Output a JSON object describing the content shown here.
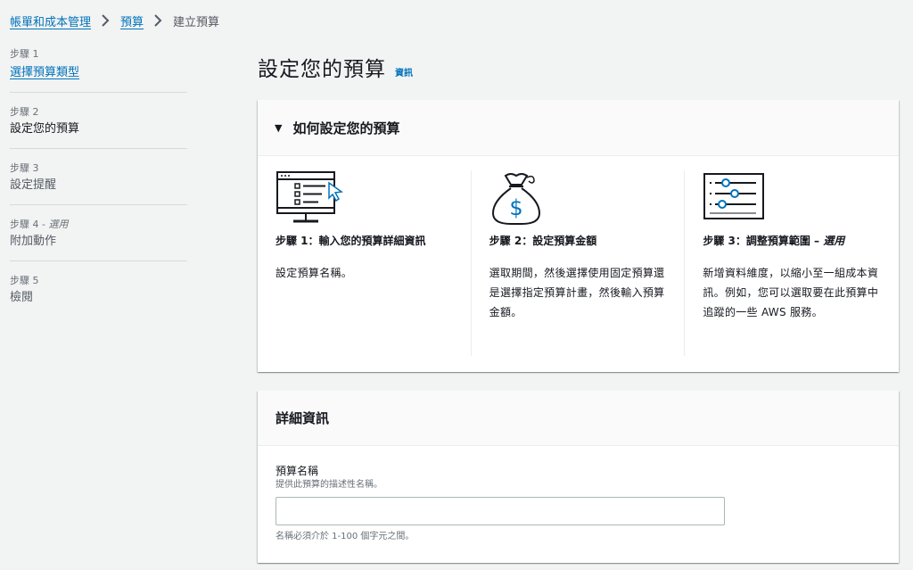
{
  "breadcrumb": {
    "items": [
      "帳單和成本管理",
      "預算"
    ],
    "current": "建立預算"
  },
  "steps": [
    {
      "num": "步驟 1",
      "label": "選擇預算類型",
      "state": "link"
    },
    {
      "num": "步驟 2",
      "label": "設定您的預算",
      "state": "active"
    },
    {
      "num": "步驟 3",
      "label": "設定提醒",
      "state": "disabled"
    },
    {
      "num": "步驟 4 -",
      "optional": "選用",
      "label": "附加動作",
      "state": "disabled"
    },
    {
      "num": "步驟 5",
      "label": "檢閱",
      "state": "disabled"
    }
  ],
  "main": {
    "title": "設定您的預算",
    "info_link": "資訊"
  },
  "how_panel": {
    "caret": "▼",
    "title": "如何設定您的預算",
    "columns": [
      {
        "icon": "monitor-form-icon",
        "title": "步驟 1：輸入您的預算詳細資訊",
        "optional": "",
        "desc": "設定預算名稱。"
      },
      {
        "icon": "money-bag-icon",
        "title": "步驟 2：設定預算金額",
        "optional": "",
        "desc": "選取期間，然後選擇使用固定預算還是選擇指定預算計畫，然後輸入預算金額。"
      },
      {
        "icon": "sliders-icon",
        "title": "步驟 3：調整預算範圍 –",
        "optional": "選用",
        "desc": "新增資料維度，以縮小至一組成本資訊。例如，您可以選取要在此預算中追蹤的一些 AWS 服務。"
      }
    ]
  },
  "details_panel": {
    "title": "詳細資訊",
    "name_label": "預算名稱",
    "name_desc": "提供此預算的描述性名稱。",
    "name_value": "",
    "name_constraint": "名稱必須介於 1-100 個字元之間。"
  },
  "colors": {
    "link": "#0073bb",
    "text": "#16191f",
    "muted": "#687078",
    "background": "#f2f3f3"
  }
}
